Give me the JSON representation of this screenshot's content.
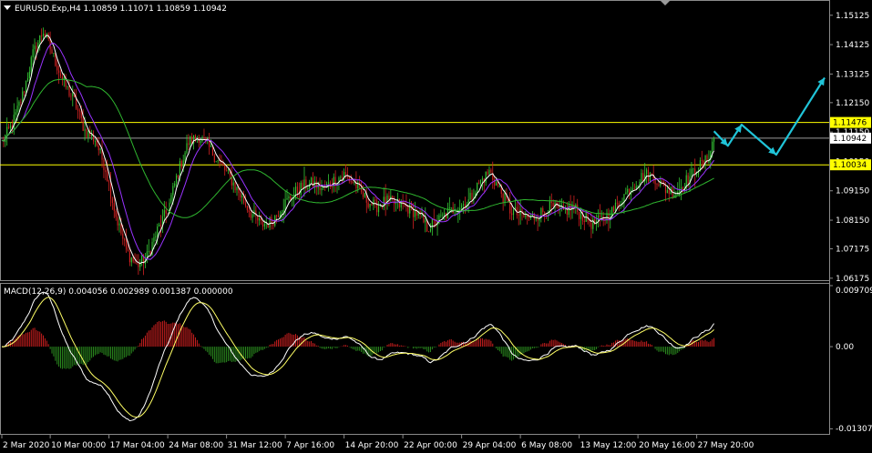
{
  "main_title": "EURUSD.Exp,H4  1.10859 1.11071 1.10859 1.10942",
  "macd_title": "MACD(12,26,9) 0.004056 0.002989 0.001387 0.000000",
  "colors": {
    "bull": "#34c734",
    "bear": "#d22222",
    "ma_fast": "#ffffff",
    "ma_mid": "#9933ff",
    "ma_slow": "#2fb52f",
    "level": "#ffff00",
    "forecast": "#20c4d8",
    "macd_pos": "#c81e1e",
    "macd_neg": "#2a8a1e",
    "macd_line": "#ffffff",
    "signal_line": "#ffff66"
  },
  "chart_data": [
    {
      "type": "candlestick",
      "symbol": "EURUSD.Exp",
      "timeframe": "H4",
      "ohlc_last": {
        "open": 1.10859,
        "high": 1.11071,
        "low": 1.10859,
        "close": 1.10942
      },
      "ylim": [
        1.0617,
        1.1552
      ],
      "y_ticks": [
        1.15125,
        1.14125,
        1.13125,
        1.1215,
        1.1115,
        1.1015,
        1.0915,
        1.0815,
        1.07175,
        1.06175
      ],
      "y_tick_labels": [
        "1.15125",
        "1.14125",
        "1.13125",
        "1.12150",
        "1.11150",
        "1.10150",
        "1.09150",
        "1.08150",
        "1.07175",
        "1.06175"
      ],
      "x_labels": [
        "2 Mar 2020",
        "10 Mar 00:00",
        "17 Mar 04:00",
        "24 Mar 08:00",
        "31 Mar 12:00",
        "7 Apr 16:00",
        "14 Apr 20:00",
        "22 Apr 00:00",
        "29 Apr 04:00",
        "6 May 08:00",
        "13 May 12:00",
        "20 May 16:00",
        "27 May 20:00"
      ],
      "x_label_bars": [
        0,
        28,
        62,
        96,
        130,
        164,
        198,
        232,
        266,
        300,
        334,
        368,
        402
      ],
      "levels": [
        {
          "price": 1.11476,
          "label": "1.11476"
        },
        {
          "price": 1.10034,
          "label": "1.10034"
        }
      ],
      "current_price": {
        "price": 1.10942,
        "label": "1.10942"
      },
      "close_keypoints": [
        [
          0,
          1.108
        ],
        [
          6,
          1.114
        ],
        [
          12,
          1.124
        ],
        [
          18,
          1.138
        ],
        [
          24,
          1.146
        ],
        [
          30,
          1.137
        ],
        [
          36,
          1.128
        ],
        [
          42,
          1.122
        ],
        [
          48,
          1.112
        ],
        [
          54,
          1.109
        ],
        [
          60,
          1.099
        ],
        [
          66,
          1.083
        ],
        [
          72,
          1.071
        ],
        [
          78,
          1.066
        ],
        [
          84,
          1.069
        ],
        [
          90,
          1.078
        ],
        [
          96,
          1.085
        ],
        [
          102,
          1.098
        ],
        [
          108,
          1.108
        ],
        [
          114,
          1.11
        ],
        [
          120,
          1.106
        ],
        [
          126,
          1.101
        ],
        [
          132,
          1.096
        ],
        [
          138,
          1.09
        ],
        [
          144,
          1.084
        ],
        [
          150,
          1.08
        ],
        [
          156,
          1.081
        ],
        [
          162,
          1.086
        ],
        [
          168,
          1.09
        ],
        [
          174,
          1.093
        ],
        [
          180,
          1.094
        ],
        [
          186,
          1.092
        ],
        [
          192,
          1.095
        ],
        [
          198,
          1.097
        ],
        [
          204,
          1.094
        ],
        [
          210,
          1.089
        ],
        [
          216,
          1.086
        ],
        [
          222,
          1.088
        ],
        [
          228,
          1.087
        ],
        [
          234,
          1.086
        ],
        [
          240,
          1.084
        ],
        [
          246,
          1.079
        ],
        [
          252,
          1.081
        ],
        [
          258,
          1.084
        ],
        [
          264,
          1.086
        ],
        [
          270,
          1.088
        ],
        [
          276,
          1.094
        ],
        [
          282,
          1.098
        ],
        [
          288,
          1.092
        ],
        [
          294,
          1.085
        ],
        [
          300,
          1.083
        ],
        [
          306,
          1.082
        ],
        [
          312,
          1.084
        ],
        [
          318,
          1.086
        ],
        [
          324,
          1.084
        ],
        [
          330,
          1.086
        ],
        [
          336,
          1.083
        ],
        [
          342,
          1.08
        ],
        [
          348,
          1.082
        ],
        [
          354,
          1.085
        ],
        [
          360,
          1.09
        ],
        [
          366,
          1.094
        ],
        [
          372,
          1.097
        ],
        [
          378,
          1.096
        ],
        [
          384,
          1.092
        ],
        [
          390,
          1.091
        ],
        [
          396,
          1.095
        ],
        [
          402,
          1.099
        ],
        [
          408,
          1.102
        ],
        [
          412,
          1.1094
        ]
      ],
      "forecast_path": [
        [
          412,
          1.1118
        ],
        [
          420,
          1.1068
        ],
        [
          428,
          1.114
        ],
        [
          448,
          1.1038
        ],
        [
          476,
          1.13
        ]
      ],
      "bars_total": 412,
      "x_span_bars": 476
    },
    {
      "type": "macd",
      "params": "12,26,9",
      "values": {
        "macd": 0.004056,
        "signal": 0.002989,
        "histogram": 0.001387
      },
      "ylim": [
        -0.01374,
        0.00971
      ],
      "y_tick_labels": [
        "0.009709",
        "0.00",
        "-0.013074"
      ],
      "y_ticks": [
        0.009709,
        0.0,
        -0.013074
      ]
    }
  ]
}
